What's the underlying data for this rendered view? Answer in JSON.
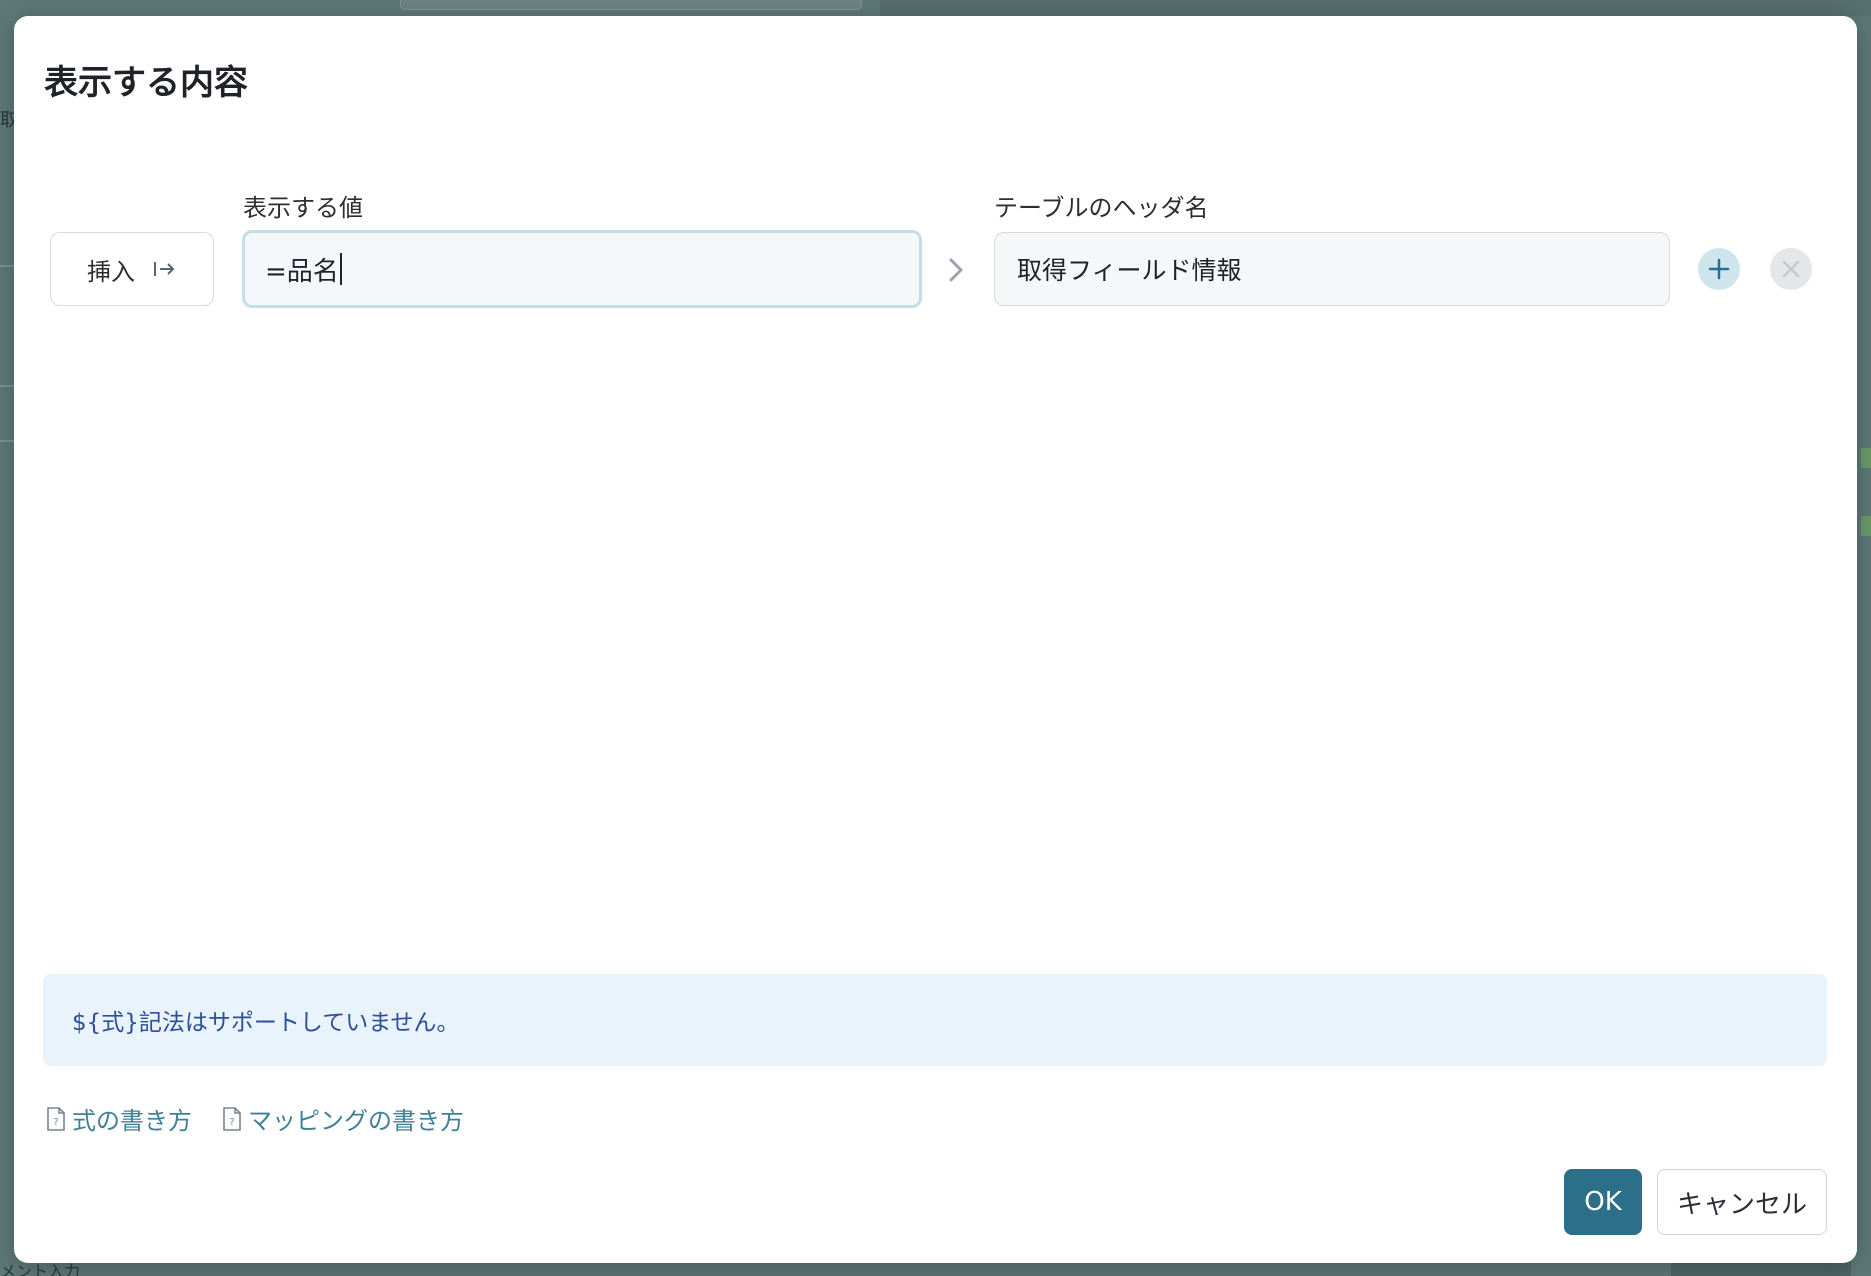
{
  "background": {
    "left_fragment": "取",
    "bottom_fragment": "メント入力"
  },
  "dialog": {
    "title": "表示する内容",
    "value_column_label": "表示する値",
    "header_column_label": "テーブルのヘッダ名",
    "insert_button_label": "挿入",
    "rows": [
      {
        "value": "=品名",
        "header": "取得フィールド情報"
      }
    ],
    "info_message": "${式}記法はサポートしていません。",
    "links": [
      {
        "label": "式の書き方",
        "icon": "document-icon"
      },
      {
        "label": "マッピングの書き方",
        "icon": "document-icon"
      }
    ],
    "ok_label": "OK",
    "cancel_label": "キャンセル"
  },
  "colors": {
    "primary": "#2b6f89",
    "link": "#3f8099",
    "info_bg": "#e8f3fc",
    "info_text": "#2f4e9a",
    "focus_border": "#c4dde6"
  }
}
